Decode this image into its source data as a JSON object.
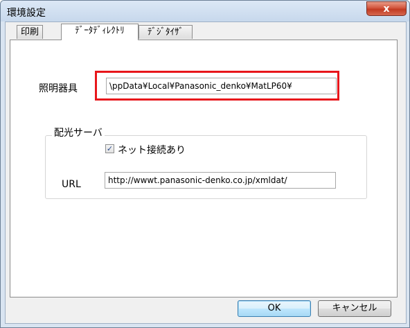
{
  "window": {
    "title": "環境設定",
    "close_glyph": "x"
  },
  "tabs": [
    {
      "label": "印刷"
    },
    {
      "label": "ﾃﾞｰﾀﾃﾞｨﾚｸﾄﾘ"
    },
    {
      "label": "ﾃﾞｼﾞﾀｲｻﾞ"
    }
  ],
  "active_tab": "ﾃﾞｰﾀﾃﾞｨﾚｸﾄﾘ",
  "lighting": {
    "label": "照明器具",
    "path_value": "\\ppData¥Local¥Panasonic_denko¥MatLP60¥"
  },
  "server_group": {
    "title": "配光サーバ",
    "net_checkbox_label": "ネット接続あり",
    "net_checked": true,
    "url_label": "URL",
    "url_value": "http://wwwt.panasonic-denko.co.jp/xmldat/"
  },
  "buttons": {
    "ok": "OK",
    "cancel": "キャンセル"
  },
  "colors": {
    "highlight": "#e8161b"
  }
}
